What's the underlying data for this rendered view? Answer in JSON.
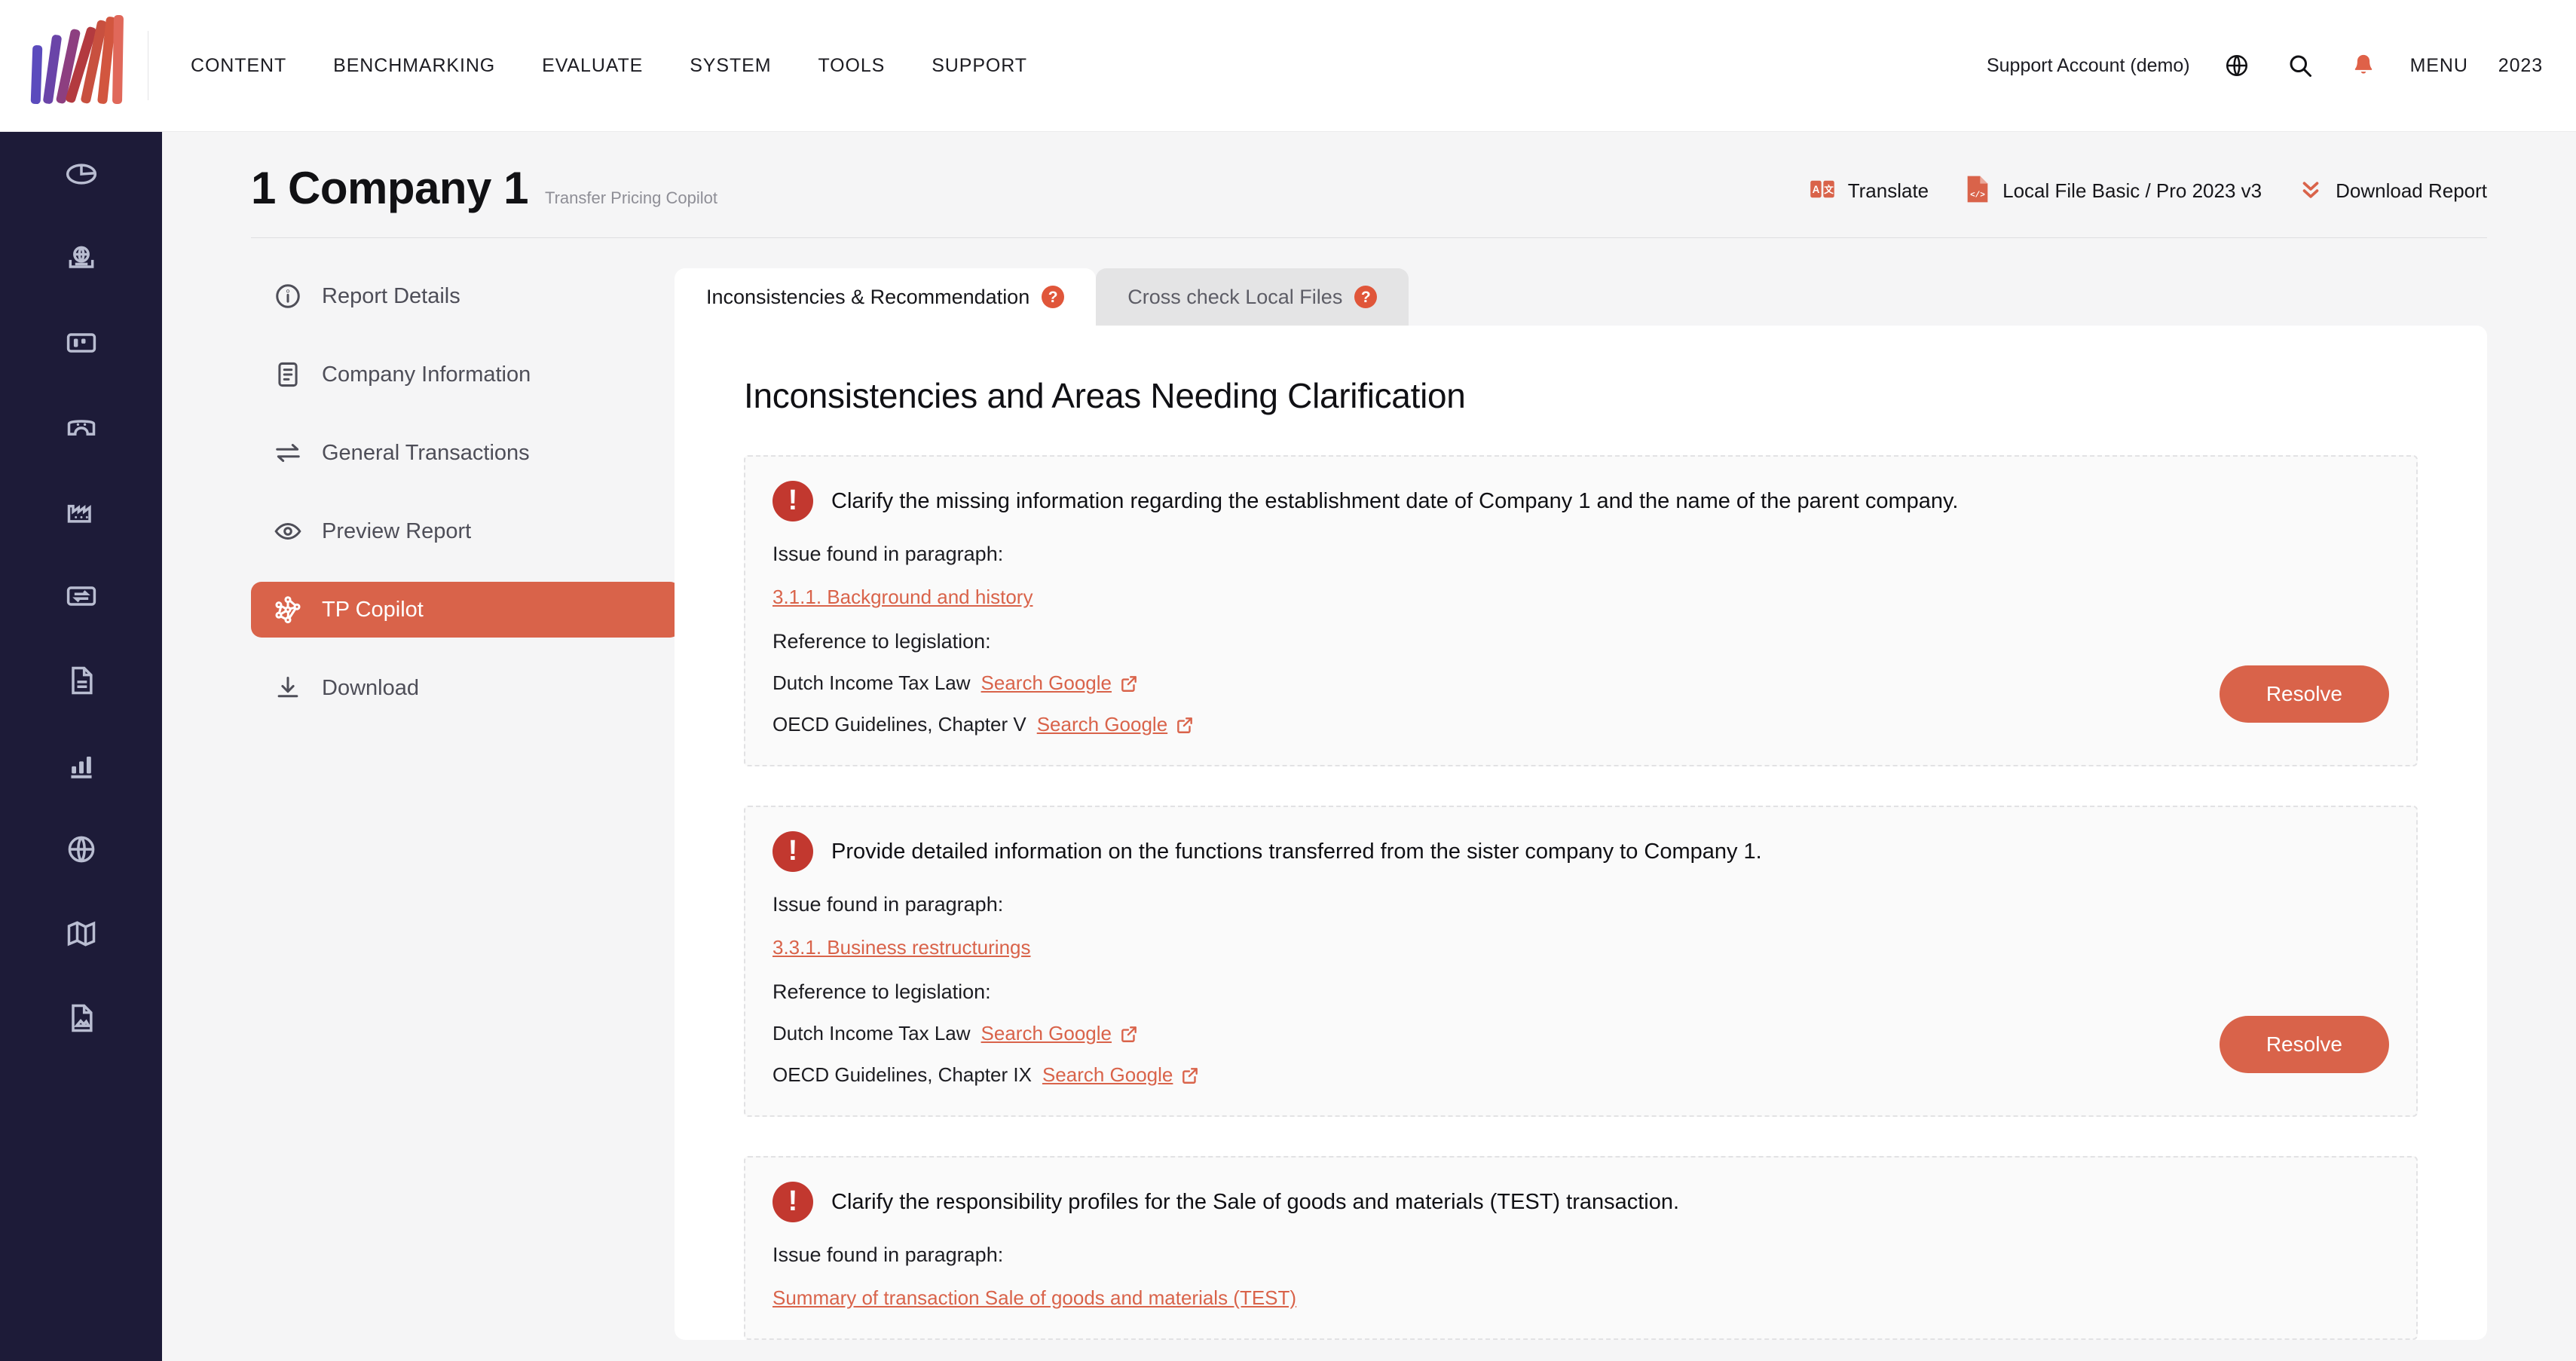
{
  "brand": {
    "accent": "#d9634a",
    "rail_bg": "#1d1b38",
    "alert_red": "#c2382f"
  },
  "topbar": {
    "nav": [
      {
        "label": "CONTENT",
        "name": "nav-content"
      },
      {
        "label": "BENCHMARKING",
        "name": "nav-benchmarking"
      },
      {
        "label": "EVALUATE",
        "name": "nav-evaluate"
      },
      {
        "label": "SYSTEM",
        "name": "nav-system"
      },
      {
        "label": "TOOLS",
        "name": "nav-tools"
      },
      {
        "label": "SUPPORT",
        "name": "nav-support"
      }
    ],
    "account": "Support Account (demo)",
    "menu_label": "MENU",
    "year_label": "2023",
    "icons": [
      "globe-icon",
      "search-icon",
      "bell-icon"
    ]
  },
  "icon_rail": {
    "items": [
      {
        "name": "pie-chart-icon"
      },
      {
        "name": "globe-card-icon"
      },
      {
        "name": "layout-panels-icon"
      },
      {
        "name": "bridge-icon"
      },
      {
        "name": "factory-icon"
      },
      {
        "name": "transfer-box-icon"
      },
      {
        "name": "document-lines-icon"
      },
      {
        "name": "bar-chart-icon"
      },
      {
        "name": "globe-grid-icon"
      },
      {
        "name": "map-icon"
      },
      {
        "name": "document-image-icon"
      }
    ]
  },
  "page": {
    "title": "1 Company 1",
    "subtitle": "Transfer Pricing Copilot",
    "actions": [
      {
        "name": "translate-action",
        "label": "Translate",
        "icon": "translate-icon"
      },
      {
        "name": "local-file-action",
        "label": "Local File Basic / Pro 2023 v3",
        "icon": "file-code-icon"
      },
      {
        "name": "download-report-action",
        "label": "Download Report",
        "icon": "double-chevron-down-icon"
      }
    ]
  },
  "section_nav": {
    "items": [
      {
        "label": "Report Details",
        "name": "sidebar-item-report-details",
        "icon": "info-circle-icon",
        "active": false
      },
      {
        "label": "Company Information",
        "name": "sidebar-item-company-information",
        "icon": "document-icon",
        "active": false
      },
      {
        "label": "General Transactions",
        "name": "sidebar-item-general-transactions",
        "icon": "exchange-arrows-icon",
        "active": false
      },
      {
        "label": "Preview Report",
        "name": "sidebar-item-preview-report",
        "icon": "eye-icon",
        "active": false
      },
      {
        "label": "TP Copilot",
        "name": "sidebar-item-tp-copilot",
        "icon": "network-nodes-icon",
        "active": true
      },
      {
        "label": "Download",
        "name": "sidebar-item-download",
        "icon": "download-icon",
        "active": false
      }
    ]
  },
  "tabs": [
    {
      "label": "Inconsistencies & Recommendation",
      "name": "tab-inconsistencies-recommendation",
      "active": true,
      "help": "?"
    },
    {
      "label": "Cross check Local Files",
      "name": "tab-cross-check-local-files",
      "active": false,
      "help": "?"
    }
  ],
  "panel": {
    "heading": "Inconsistencies and Areas Needing Clarification",
    "labels": {
      "paragraph": "Issue found in paragraph:",
      "legislation": "Reference to legislation:",
      "search_google": "Search Google",
      "resolve": "Resolve"
    },
    "issues": [
      {
        "title": "Clarify the missing information regarding the establishment date of Company 1 and the name of the parent company.",
        "paragraph_link": "3.1.1. Background and history",
        "legislation": [
          "Dutch Income Tax Law",
          "OECD Guidelines, Chapter V"
        ],
        "has_resolve": true
      },
      {
        "title": "Provide detailed information on the functions transferred from the sister company to Company 1.",
        "paragraph_link": "3.3.1. Business restructurings",
        "legislation": [
          "Dutch Income Tax Law",
          "OECD Guidelines, Chapter IX"
        ],
        "has_resolve": true
      },
      {
        "title": "Clarify the responsibility profiles for the Sale of goods and materials (TEST) transaction.",
        "paragraph_link": "Summary of transaction Sale of goods and materials (TEST)",
        "legislation": [],
        "has_resolve": false
      }
    ]
  }
}
